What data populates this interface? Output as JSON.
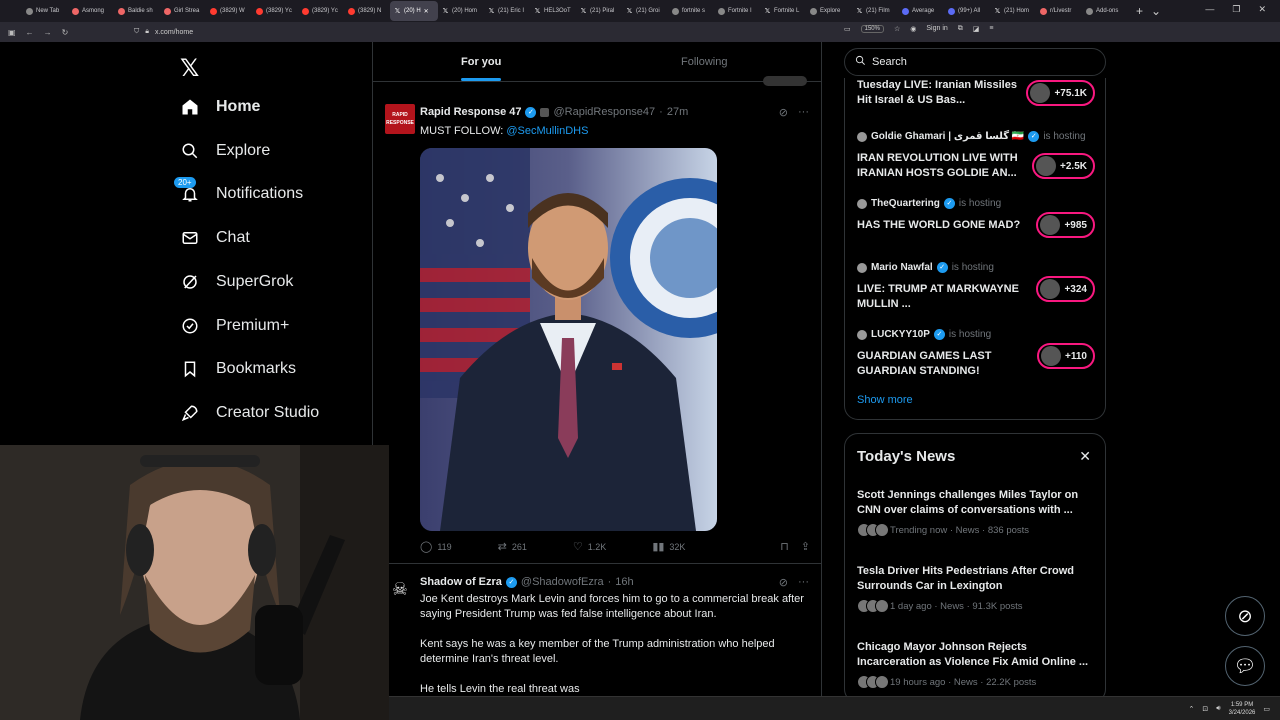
{
  "browser": {
    "tabs": [
      {
        "label": "New Tab",
        "icon": "firefox-icon"
      },
      {
        "label": "Asmong",
        "icon": "twitch-icon"
      },
      {
        "label": "Baldie sh",
        "icon": "twitch-icon"
      },
      {
        "label": "Girl Strea",
        "icon": "twitch-icon"
      },
      {
        "label": "(3829) W",
        "icon": "youtube-icon"
      },
      {
        "label": "(3829) Yc",
        "icon": "youtube-icon"
      },
      {
        "label": "(3829) Yc",
        "icon": "youtube-icon"
      },
      {
        "label": "(3829) N",
        "icon": "youtube-icon"
      },
      {
        "label": "(20) H",
        "icon": "x-icon",
        "active": true
      },
      {
        "label": "(20) Hom",
        "icon": "x-icon"
      },
      {
        "label": "(21) Eric I",
        "icon": "x-icon"
      },
      {
        "label": "HEL3OoT",
        "icon": "x-icon"
      },
      {
        "label": "(21) Piral",
        "icon": "x-icon"
      },
      {
        "label": "(21) Groi",
        "icon": "x-icon"
      },
      {
        "label": "fortnite s",
        "icon": "google-icon"
      },
      {
        "label": "Fortnite I",
        "icon": "web-icon"
      },
      {
        "label": "Fortnite L",
        "icon": "x-icon"
      },
      {
        "label": "Explore",
        "icon": "web-icon"
      },
      {
        "label": "(21) Film",
        "icon": "x-icon"
      },
      {
        "label": "Average",
        "icon": "web-icon"
      },
      {
        "label": "(99+) All",
        "icon": "web-icon"
      },
      {
        "label": "(21) Hom",
        "icon": "x-icon"
      },
      {
        "label": "r/Livestr",
        "icon": "reddit-icon"
      },
      {
        "label": "Add-ons",
        "icon": "puzzle-icon"
      }
    ],
    "url": "x.com/home",
    "zoom": "150%",
    "sign_in": "Sign in"
  },
  "nav": {
    "items": [
      {
        "label": "Home",
        "icon": "home-icon"
      },
      {
        "label": "Explore",
        "icon": "search-icon"
      },
      {
        "label": "Notifications",
        "icon": "bell-icon",
        "badge": "20+"
      },
      {
        "label": "Chat",
        "icon": "mail-icon"
      },
      {
        "label": "SuperGrok",
        "icon": "grok-icon"
      },
      {
        "label": "Premium+",
        "icon": "verified-icon"
      },
      {
        "label": "Bookmarks",
        "icon": "bookmark-icon"
      },
      {
        "label": "Creator Studio",
        "icon": "rocket-icon"
      }
    ]
  },
  "feed": {
    "tab_foryou": "For you",
    "tab_following": "Following",
    "posts": [
      {
        "name": "Rapid Response 47",
        "handle": "@RapidResponse47",
        "time": "27m",
        "avatar_text": "RAPID RESPONSE",
        "text_prefix": "MUST FOLLOW: ",
        "mention": "@SecMullinDHS",
        "replies": "119",
        "reposts": "261",
        "likes": "1.2K",
        "views": "32K"
      },
      {
        "name": "Shadow of Ezra",
        "handle": "@ShadowofEzra",
        "time": "16h",
        "p1": "Joe Kent destroys Mark Levin and forces him to go to a commercial break after saying President Trump was fed false intelligence about Iran.",
        "p2": "Kent says he was a key member of the Trump administration who helped determine Iran's threat level.",
        "p3": "He tells Levin the real threat was"
      }
    ]
  },
  "right": {
    "search_placeholder": "Search",
    "live": [
      {
        "title": "Tuesday LIVE: Iranian Missiles Hit Israel & US Bas...",
        "count": "+75.1K"
      },
      {
        "host": "Goldie Ghamari | گلسا قمری 🇮🇷",
        "status": "is hosting",
        "title": "IRAN REVOLUTION LIVE WITH IRANIAN HOSTS GOLDIE AN...",
        "count": "+2.5K"
      },
      {
        "host": "TheQuartering",
        "status": "is hosting",
        "title": "HAS THE WORLD GONE MAD?",
        "count": "+985"
      },
      {
        "host": "Mario Nawfal",
        "status": "is hosting",
        "title": "LIVE: TRUMP AT MARKWAYNE MULLIN ...",
        "count": "+324"
      },
      {
        "host": "LUCKYY10P",
        "status": "is hosting",
        "title": "GUARDIAN GAMES LAST GUARDIAN STANDING!",
        "count": "+110"
      }
    ],
    "show_more": "Show more",
    "news_title": "Today's News",
    "news": [
      {
        "headline": "Scott Jennings challenges Miles Taylor on CNN over claims of conversations with ...",
        "meta": "Trending now · News · 836 posts"
      },
      {
        "headline": "Tesla Driver Hits Pedestrians After Crowd Surrounds Car in Lexington",
        "meta": "1 day ago · News · 91.3K posts"
      },
      {
        "headline": "Chicago Mayor Johnson Rejects Incarceration as Violence Fix Amid Online ...",
        "meta": "19 hours ago · News · 22.2K posts"
      }
    ]
  },
  "taskbar": {
    "time": "1:59 PM",
    "date": "3/24/2026"
  },
  "colors": {
    "accent": "#1d9bf0",
    "live_ring": "#f91880",
    "background": "#000000"
  }
}
